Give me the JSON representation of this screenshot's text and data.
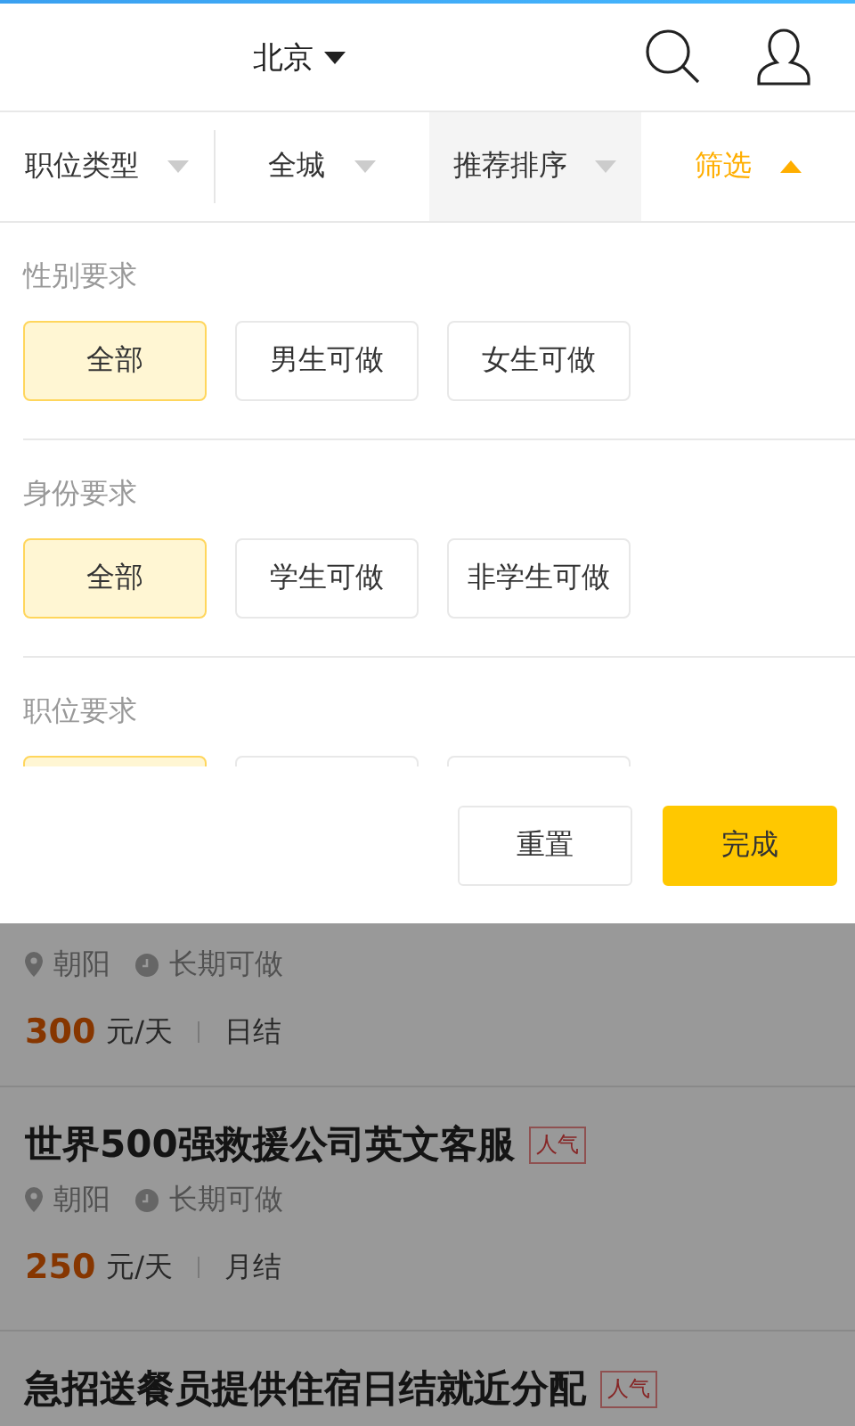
{
  "header": {
    "city": "北京"
  },
  "filter_tabs": [
    {
      "label": "职位类型",
      "selected": false,
      "shaded": false
    },
    {
      "label": "全城",
      "selected": false,
      "shaded": false
    },
    {
      "label": "推荐排序",
      "selected": false,
      "shaded": true
    },
    {
      "label": "筛选",
      "selected": true,
      "shaded": false
    }
  ],
  "filter_sections": [
    {
      "title": "性别要求",
      "options": [
        {
          "label": "全部",
          "selected": true
        },
        {
          "label": "男生可做",
          "selected": false
        },
        {
          "label": "女生可做",
          "selected": false
        }
      ]
    },
    {
      "title": "身份要求",
      "options": [
        {
          "label": "全部",
          "selected": true
        },
        {
          "label": "学生可做",
          "selected": false
        },
        {
          "label": "非学生可做",
          "selected": false
        }
      ]
    },
    {
      "title": "职位要求",
      "options": [
        {
          "selected": true
        },
        {
          "selected": false
        },
        {
          "selected": false
        }
      ]
    }
  ],
  "actions": {
    "reset": "重置",
    "done": "完成"
  },
  "jobs": [
    {
      "location": "朝阳",
      "duration": "长期可做",
      "pay": "300",
      "unit": "元/天",
      "settlement": "日结"
    },
    {
      "title": "世界500强救援公司英文客服",
      "tag": "人气",
      "location": "朝阳",
      "duration": "长期可做",
      "pay": "250",
      "unit": "元/天",
      "settlement": "月结"
    },
    {
      "title": "急招送餐员提供住宿日结就近分配",
      "tag": "人气"
    }
  ]
}
